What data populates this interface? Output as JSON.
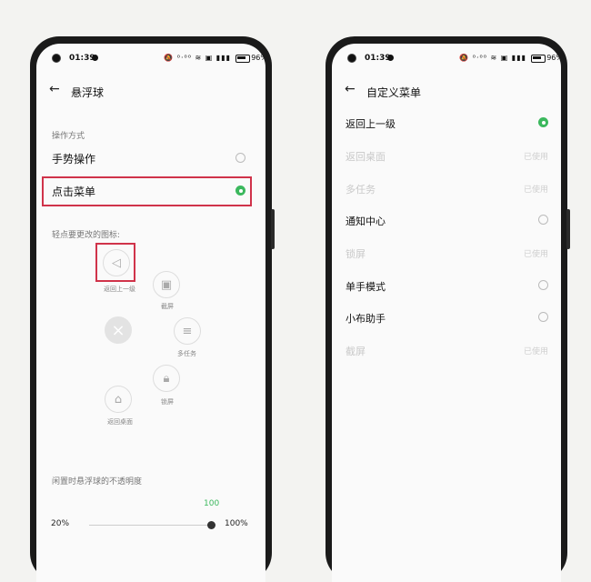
{
  "status": {
    "time": "01:39",
    "icons": "🔕 ⁰·⁰⁰ ≋ ▣ ▮▮▮",
    "battery": "96%"
  },
  "left": {
    "title": "悬浮球",
    "section_operation": "操作方式",
    "option_gesture": "手势操作",
    "option_menu": "点击菜单",
    "hint": "轻点要更改的图标:",
    "balls": {
      "back": "返回上一级",
      "screenshot": "截屏",
      "multitask": "多任务",
      "lock": "锁屏",
      "home": "返回桌面"
    },
    "opacity_label": "闲置时悬浮球的不透明度",
    "opacity_value": "100",
    "opacity_min": "20%",
    "opacity_max": "100%"
  },
  "right": {
    "title": "自定义菜单",
    "items": [
      {
        "label": "返回上一级",
        "state": "selected"
      },
      {
        "label": "返回桌面",
        "state": "used",
        "used_text": "已使用"
      },
      {
        "label": "多任务",
        "state": "used",
        "used_text": "已使用"
      },
      {
        "label": "通知中心",
        "state": "unselected"
      },
      {
        "label": "锁屏",
        "state": "used",
        "used_text": "已使用"
      },
      {
        "label": "单手模式",
        "state": "unselected"
      },
      {
        "label": "小布助手",
        "state": "unselected"
      },
      {
        "label": "截屏",
        "state": "used",
        "used_text": "已使用"
      }
    ]
  },
  "colors": {
    "accent": "#3bb85d",
    "highlight": "#d0334a"
  }
}
